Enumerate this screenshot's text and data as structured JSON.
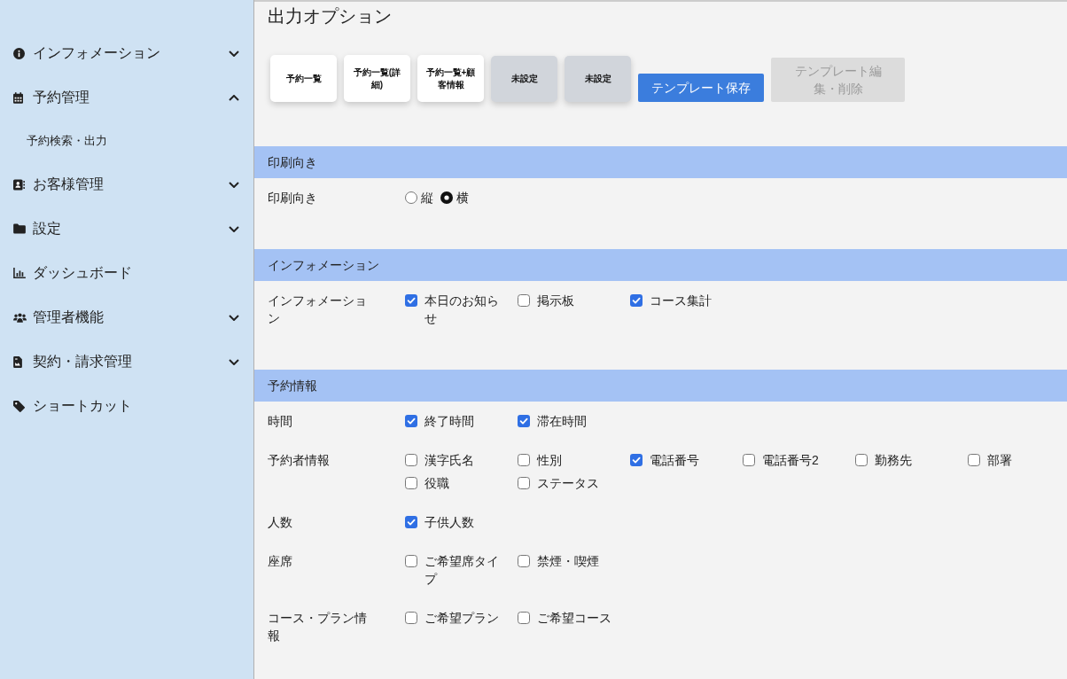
{
  "sidebar": {
    "items": [
      {
        "label": "インフォメーション",
        "kind": "group",
        "expanded": false
      },
      {
        "label": "予約管理",
        "kind": "group",
        "expanded": true,
        "children": [
          {
            "label": "予約検索・出力"
          }
        ]
      },
      {
        "label": "お客様管理",
        "kind": "group",
        "expanded": false
      },
      {
        "label": "設定",
        "kind": "group",
        "expanded": false
      },
      {
        "label": "ダッシュボード",
        "kind": "link"
      },
      {
        "label": "管理者機能",
        "kind": "group",
        "expanded": false
      },
      {
        "label": "契約・請求管理",
        "kind": "group",
        "expanded": false
      },
      {
        "label": "ショートカット",
        "kind": "link"
      }
    ]
  },
  "title": "出力オプション",
  "templates": [
    {
      "label": "予約一覧",
      "configured": true
    },
    {
      "label": "予約一覧(詳細)",
      "configured": true
    },
    {
      "label": "予約一覧+顧客情報",
      "configured": true
    },
    {
      "label": "未設定",
      "configured": false
    },
    {
      "label": "未設定",
      "configured": false
    }
  ],
  "actions": [
    {
      "label": "テンプレート保存",
      "disabled": false
    },
    {
      "label": "テンプレート編集・削除",
      "disabled": true
    }
  ],
  "sections": [
    {
      "title": "印刷向き",
      "rows": [
        {
          "label": "印刷向き",
          "kind": "radio",
          "options": [
            {
              "label": "縦",
              "selected": false
            },
            {
              "label": "横",
              "selected": true
            }
          ]
        }
      ]
    },
    {
      "title": "インフォメーション",
      "rows": [
        {
          "label": "インフォメーション",
          "kind": "checkbox",
          "options": [
            {
              "label": "本日のお知らせ",
              "checked": true
            },
            {
              "label": "掲示板",
              "checked": false
            },
            {
              "label": "コース集計",
              "checked": true
            }
          ]
        }
      ]
    },
    {
      "title": "予約情報",
      "rows": [
        {
          "label": "時間",
          "kind": "checkbox",
          "options": [
            {
              "label": "終了時間",
              "checked": true
            },
            {
              "label": "滞在時間",
              "checked": true
            }
          ]
        },
        {
          "label": "予約者情報",
          "kind": "checkbox",
          "options": [
            {
              "label": "漢字氏名",
              "checked": false
            },
            {
              "label": "性別",
              "checked": false
            },
            {
              "label": "電話番号",
              "checked": true
            },
            {
              "label": "電話番号2",
              "checked": false
            },
            {
              "label": "勤務先",
              "checked": false
            },
            {
              "label": "部署",
              "checked": false
            },
            {
              "label": "役職",
              "checked": false
            },
            {
              "label": "ステータス",
              "checked": false
            }
          ]
        },
        {
          "label": "人数",
          "kind": "checkbox",
          "options": [
            {
              "label": "子供人数",
              "checked": true
            }
          ]
        },
        {
          "label": "座席",
          "kind": "checkbox",
          "options": [
            {
              "label": "ご希望席タイプ",
              "checked": false
            },
            {
              "label": "禁煙・喫煙",
              "checked": false
            }
          ]
        },
        {
          "label": "コース・プラン情報",
          "kind": "checkbox",
          "options": [
            {
              "label": "ご希望プラン",
              "checked": false
            },
            {
              "label": "ご希望コース",
              "checked": false
            }
          ]
        }
      ]
    }
  ]
}
